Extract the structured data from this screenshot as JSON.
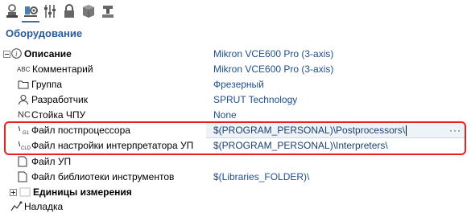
{
  "toolbar": {
    "icons": [
      "hand-probe-icon",
      "tool-settings-icon",
      "sliders-icon",
      "lock-icon",
      "cube-icon",
      "machine-icon"
    ]
  },
  "section": {
    "title": "Оборудование"
  },
  "properties": {
    "description": {
      "label": "Описание",
      "value": "Mikron VCE600 Pro (3-axis)"
    },
    "comment": {
      "label": "Комментарий",
      "value": "Mikron VCE600 Pro (3-axis)",
      "icon_text": "ABC"
    },
    "group": {
      "label": "Группа",
      "value": "Фрезерный"
    },
    "developer": {
      "label": "Разработчик",
      "value": "SPRUT Technology"
    },
    "cnc": {
      "label": "Стойка ЧПУ",
      "value": "None",
      "icon_text": "NC"
    },
    "postprocessor": {
      "label": "Файл постпроцессора",
      "value": "$(PROGRAM_PERSONAL)\\Postprocessors\\",
      "button": "···"
    },
    "interpreter": {
      "label": "Файл настройки интерпретатора УП",
      "value": "$(PROGRAM_PERSONAL)\\Interpreters\\"
    },
    "nc_file": {
      "label": "Файл УП",
      "value": ""
    },
    "tool_library": {
      "label": "Файл библиотеки инструментов",
      "value": "$(Libraries_FOLDER)\\"
    },
    "units": {
      "label": "Единицы измерения"
    },
    "setup": {
      "label": "Наладка"
    }
  },
  "colors": {
    "accent": "#2a5a9a",
    "value_text": "#1f4e8c",
    "highlight_border": "#e82020"
  }
}
